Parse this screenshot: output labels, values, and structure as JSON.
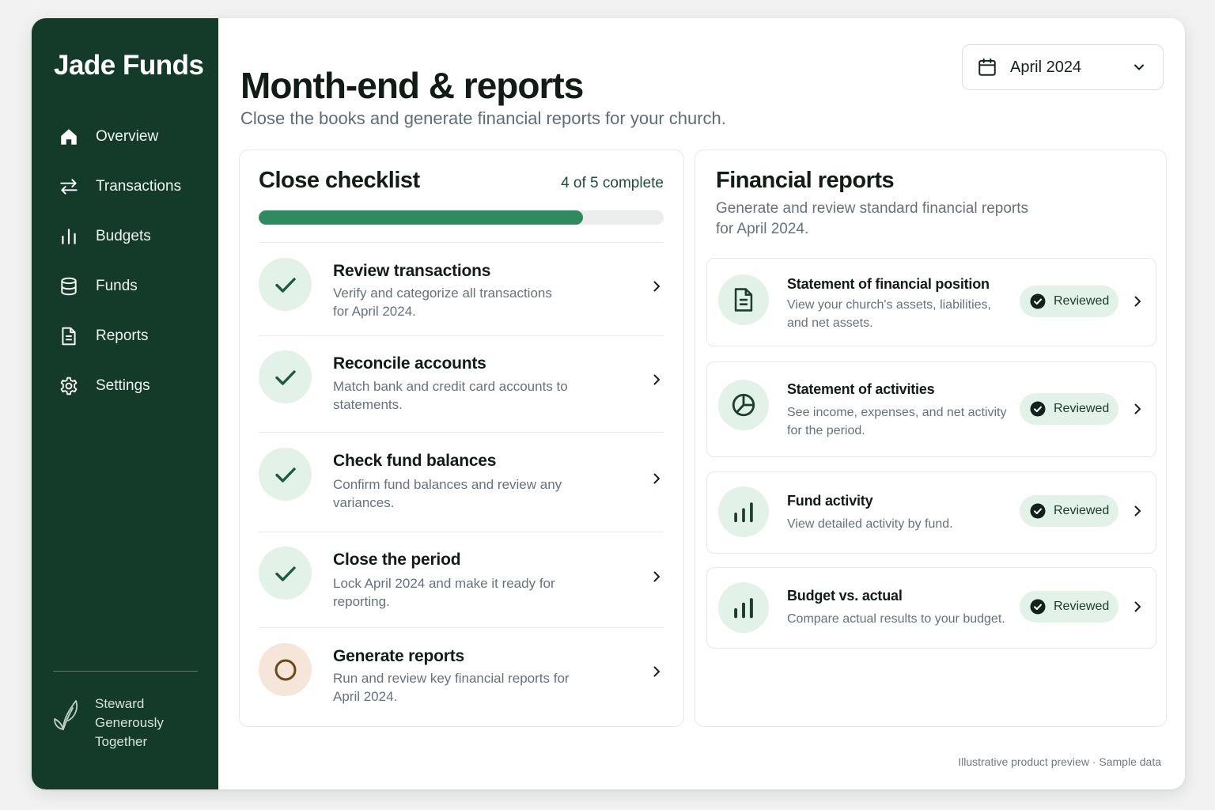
{
  "brand": {
    "name": "Jade Funds",
    "tagline": "Steward Generously Together"
  },
  "sidebar": {
    "items": [
      {
        "label": "Overview",
        "icon": "home-icon"
      },
      {
        "label": "Transactions",
        "icon": "transfer-arrows-icon"
      },
      {
        "label": "Budgets",
        "icon": "bar-chart-icon"
      },
      {
        "label": "Funds",
        "icon": "database-icon"
      },
      {
        "label": "Reports",
        "icon": "document-icon"
      },
      {
        "label": "Settings",
        "icon": "gear-icon"
      }
    ]
  },
  "header": {
    "title": "Month-end & reports",
    "subtitle": "Close the books and generate financial reports for your church.",
    "period": "April 2024"
  },
  "checklist": {
    "title": "Close checklist",
    "progress_text": "4 of 5 complete",
    "progress_fraction": 0.8,
    "items": [
      {
        "title": "Review transactions",
        "desc": "Verify and categorize all transactions for April 2024.",
        "status": "done"
      },
      {
        "title": "Reconcile accounts",
        "desc": "Match bank and credit card accounts to statements.",
        "status": "done"
      },
      {
        "title": "Check fund balances",
        "desc": "Confirm fund balances and review any variances.",
        "status": "done"
      },
      {
        "title": "Close the period",
        "desc": "Lock April 2024 and make it ready for reporting.",
        "status": "done"
      },
      {
        "title": "Generate reports",
        "desc": "Run and review key financial reports for April 2024.",
        "status": "pending"
      }
    ]
  },
  "reports": {
    "title": "Financial reports",
    "subtitle": "Generate and review standard financial reports for April 2024.",
    "items": [
      {
        "title": "Statement of financial position",
        "desc": "View your church's assets, liabilities, and net assets.",
        "status": "Reviewed",
        "icon": "document-icon"
      },
      {
        "title": "Statement of activities",
        "desc": "See income, expenses, and net activity for the period.",
        "status": "Reviewed",
        "icon": "pie-chart-icon"
      },
      {
        "title": "Fund activity",
        "desc": "View detailed activity by fund.",
        "status": "Reviewed",
        "icon": "bar-chart-icon"
      },
      {
        "title": "Budget vs. actual",
        "desc": "Compare actual results to your budget.",
        "status": "Reviewed",
        "icon": "bar-chart-icon"
      }
    ]
  },
  "footnote": "Illustrative product preview · Sample data",
  "colors": {
    "sidebar": "#143a2a",
    "accent": "#2e8a5f",
    "badge_done": "#e2f2e8",
    "badge_pending": "#f5e6d9",
    "pending_ring": "#6b4a14"
  }
}
